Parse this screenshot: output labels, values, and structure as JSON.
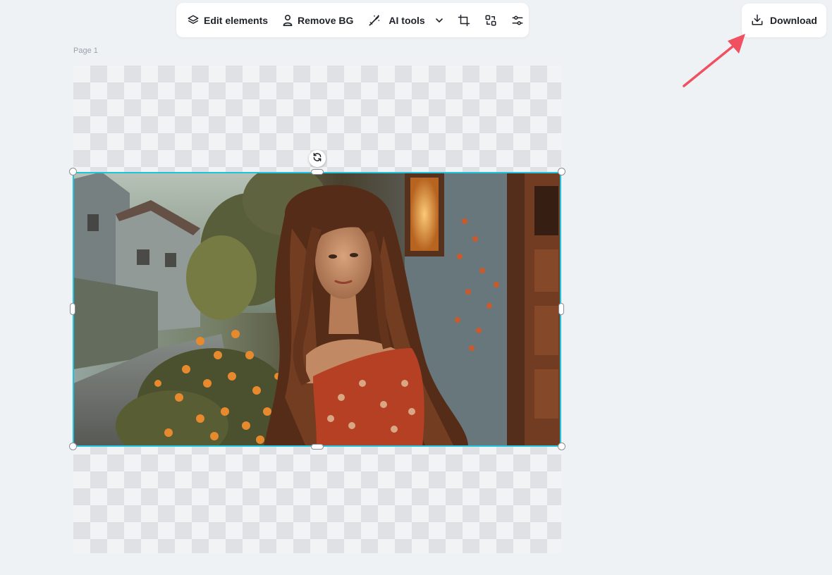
{
  "toolbar": {
    "edit_elements_label": "Edit elements",
    "remove_bg_label": "Remove BG",
    "ai_tools_label": "AI tools",
    "icons": [
      "layers-icon",
      "person-icon",
      "magic-wand-icon",
      "chevron-down-icon",
      "crop-icon",
      "swap-icon",
      "adjust-sliders-icon"
    ]
  },
  "download": {
    "label": "Download",
    "icon": "download-icon"
  },
  "page": {
    "label": "Page 1"
  },
  "canvas": {
    "background": "transparent-checkerboard",
    "selection_color": "#22c3dc"
  },
  "annotation": {
    "arrow_color": "#f0505f"
  }
}
